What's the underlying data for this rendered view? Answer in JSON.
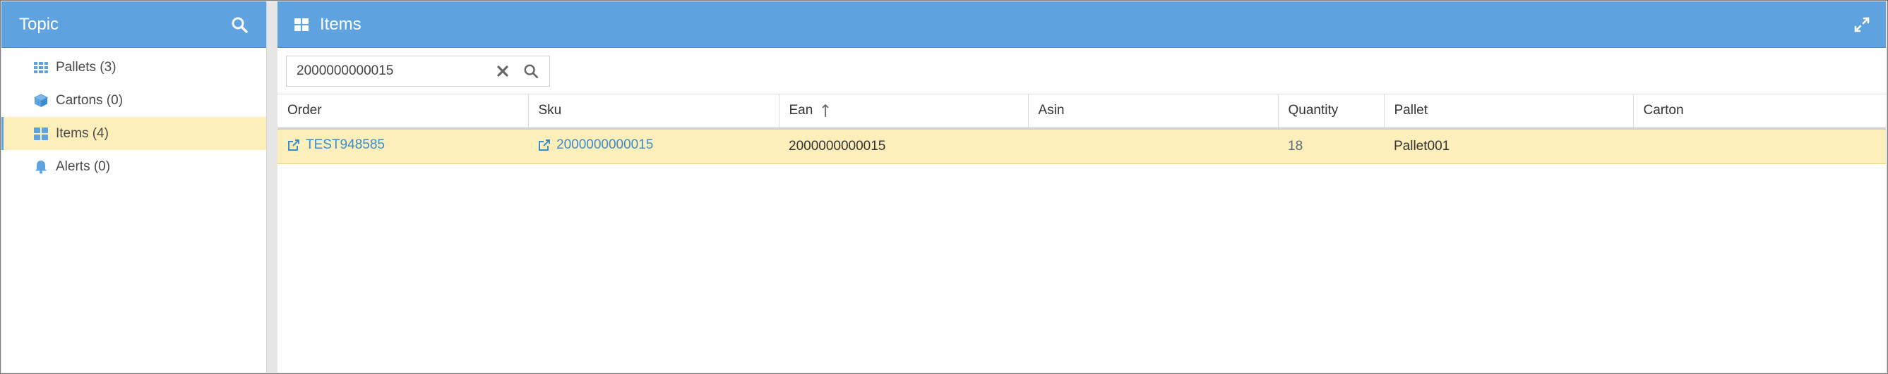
{
  "left_panel": {
    "title": "Topic",
    "items": [
      {
        "label": "Pallets (3)",
        "icon": "grid-icon",
        "selected": false
      },
      {
        "label": "Cartons (0)",
        "icon": "cube-icon",
        "selected": false
      },
      {
        "label": "Items (4)",
        "icon": "tiles-icon",
        "selected": true
      },
      {
        "label": "Alerts (0)",
        "icon": "bell-icon",
        "selected": false
      }
    ]
  },
  "right_panel": {
    "title": "Items",
    "search": {
      "value": "2000000000015",
      "placeholder": ""
    },
    "columns": [
      "Order",
      "Sku",
      "Ean",
      "Asin",
      "Quantity",
      "Pallet",
      "Carton"
    ],
    "sorted_column": "Ean",
    "sort_direction": "ascending",
    "rows": [
      {
        "order": "TEST948585",
        "sku": "2000000000015",
        "ean": "2000000000015",
        "asin": "",
        "quantity": "18",
        "pallet": "Pallet001",
        "carton": ""
      }
    ]
  },
  "colors": {
    "header_bg": "#5ea3e0",
    "selected_bg": "#fdefb9",
    "link": "#3b8ccf"
  }
}
